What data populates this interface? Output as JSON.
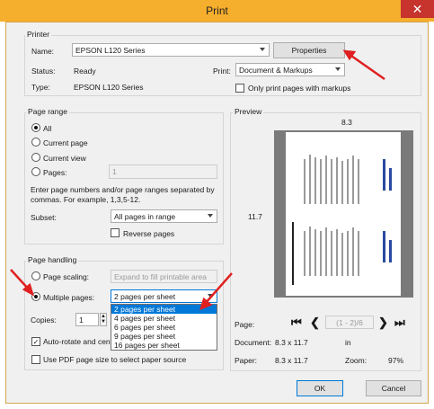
{
  "window": {
    "title": "Print",
    "close": "✕"
  },
  "printer": {
    "group_label": "Printer",
    "name_label": "Name:",
    "name_value": "EPSON L120 Series",
    "properties_button": "Properties",
    "status_label": "Status:",
    "status_value": "Ready",
    "type_label": "Type:",
    "type_value": "EPSON L120 Series",
    "print_label": "Print:",
    "print_value": "Document & Markups",
    "markups_only": "Only print pages with markups"
  },
  "page_range": {
    "group_label": "Page range",
    "all": "All",
    "current_page": "Current page",
    "current_view": "Current view",
    "pages": "Pages:",
    "pages_value": "1",
    "help": "Enter page numbers and/or page ranges separated by commas. For example, 1,3,5-12.",
    "subset_label": "Subset:",
    "subset_value": "All pages in range",
    "reverse_pages": "Reverse pages"
  },
  "page_handling": {
    "group_label": "Page handling",
    "page_scaling": "Page scaling:",
    "page_scaling_value": "Expand to fill printable area",
    "multiple_pages": "Multiple pages:",
    "multiple_pages_value": "2 pages per sheet",
    "options": [
      "2 pages per sheet",
      "4 pages per sheet",
      "6 pages per sheet",
      "9 pages per sheet",
      "16 pages per sheet"
    ],
    "copies_label": "Copies:",
    "copies_value": "1",
    "auto_rotate": "Auto-rotate and cente",
    "pdf_page_size": "Use PDF page size to select paper source"
  },
  "preview": {
    "group_label": "Preview",
    "width": "8.3",
    "height": "11.7",
    "page_label": "Page:",
    "first": "⏮",
    "prev": "❮",
    "page_indicator": "(1 - 2)/6",
    "next": "❯",
    "last": "⏭",
    "document_label": "Document:",
    "document_value": "8.3 x 11.7",
    "document_unit": "in",
    "paper_label": "Paper:",
    "paper_value": "8.3 x 11.7",
    "zoom_label": "Zoom:",
    "zoom_value": "97%"
  },
  "buttons": {
    "ok": "OK",
    "cancel": "Cancel"
  },
  "colors": {
    "titlebar": "#f6ae2d",
    "close": "#c7332d",
    "selection": "#0078d7",
    "annotation_arrow": "#e02020"
  }
}
